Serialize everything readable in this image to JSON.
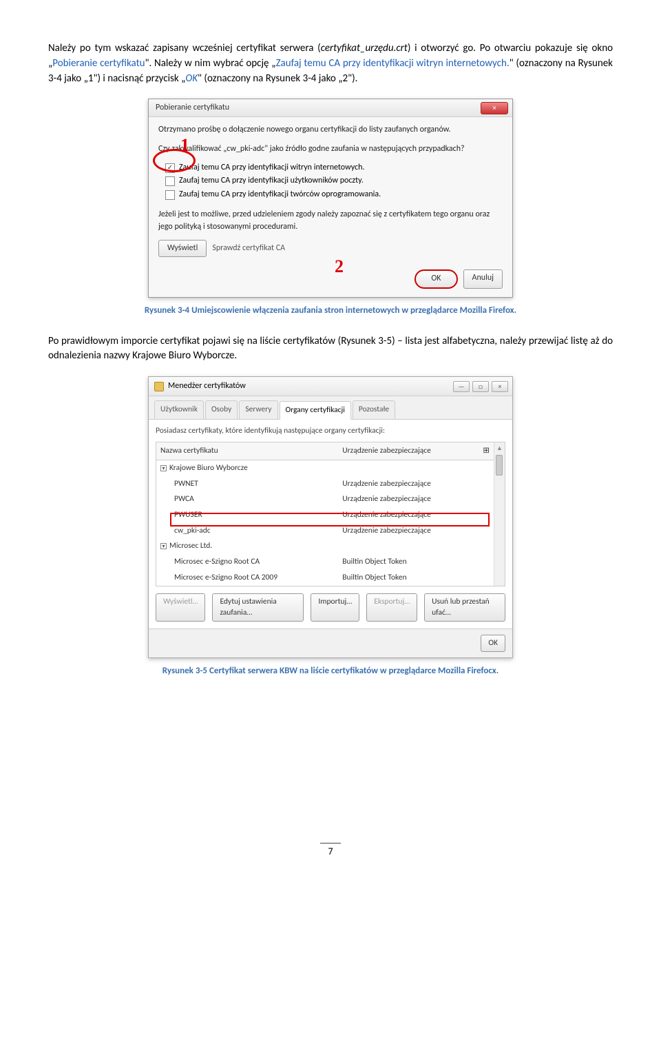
{
  "para1_a": "Należy po tym wskazać zapisany wcześniej certyfikat serwera (",
  "para1_b": "certyfikat_urzędu.crt",
  "para1_c": ") i otworzyć go. Po otwarciu pokazuje się okno „",
  "para1_d": "Pobieranie certyfikatu",
  "para1_e": "\". Należy w nim wybrać opcję „",
  "para1_f": "Zaufaj temu CA przy identyfikacji witryn internetowych.",
  "para1_g": "\" (oznaczony na Rysunek 3-4 jako „1\") i nacisnąć przycisk „",
  "para1_h": "OK",
  "para1_i": "\" (oznaczony na Rysunek 3-4 jako „2\").",
  "dlg1": {
    "title": "Pobieranie certyfikatu",
    "line1": "Otrzymano prośbę o dołączenie nowego organu certyfikacji do listy zaufanych organów.",
    "line2": "Czy zakwalifikować „cw_pki-adc\" jako źródło godne zaufania w następujących przypadkach?",
    "chk1": "Zaufaj temu CA przy identyfikacji witryn internetowych.",
    "chk2": "Zaufaj temu CA przy identyfikacji użytkowników poczty.",
    "chk3": "Zaufaj temu CA przy identyfikacji twórców oprogramowania.",
    "note": "Jeżeli jest to możliwe, przed udzieleniem zgody należy zapoznać się z certyfikatem tego organu oraz jego polityką i stosowanymi procedurami.",
    "view": "Wyświetl",
    "check": "Sprawdź certyfikat CA",
    "ok": "OK",
    "cancel": "Anuluj",
    "n1": "1",
    "n2": "2",
    "close": "×"
  },
  "caption1": "Rysunek 3-4 Umiejscowienie włączenia zaufania stron internetowych w przeglądarce Mozilla Firefox.",
  "para2": "Po prawidłowym imporcie certyfikat pojawi się na liście certyfikatów (Rysunek 3-5) – lista jest alfabetyczna, należy przewijać listę aż do odnalezienia nazwy Krajowe Biuro Wyborcze.",
  "dlg2": {
    "title": "Menedżer certyfikatów",
    "close": "×",
    "tabs": [
      "Użytkownik",
      "Osoby",
      "Serwery",
      "Organy certyfikacji",
      "Pozostałe"
    ],
    "desc": "Posiadasz certyfikaty, które identyfikują następujące organy certyfikacji:",
    "colName": "Nazwa certyfikatu",
    "colDev": "Urządzenie zabezpieczające",
    "groupA": "Krajowe Biuro Wyborcze",
    "rows": [
      {
        "name": "PWNET",
        "dev": "Urządzenie zabezpieczające"
      },
      {
        "name": "PWCA",
        "dev": "Urządzenie zabezpieczające"
      },
      {
        "name": "PWUSER",
        "dev": "Urządzenie zabezpieczające"
      },
      {
        "name": "cw_pki-adc",
        "dev": "Urządzenie zabezpieczające"
      }
    ],
    "groupB": "Microsec Ltd.",
    "rowsB": [
      {
        "name": "Microsec e-Szigno Root CA",
        "dev": "Builtin Object Token"
      },
      {
        "name": "Microsec e-Szigno Root CA 2009",
        "dev": "Builtin Object Token"
      }
    ],
    "btnView": "Wyświetl…",
    "btnEdit": "Edytuj ustawienia zaufania…",
    "btnImport": "Importuj…",
    "btnExport": "Eksportuj…",
    "btnDelete": "Usuń lub przestań ufać…",
    "ok": "OK"
  },
  "caption2": "Rysunek 3-5 Certyfikat serwera KBW na liście certyfikatów w przeglądarce Mozilla Firefocx.",
  "pageNum": "7"
}
